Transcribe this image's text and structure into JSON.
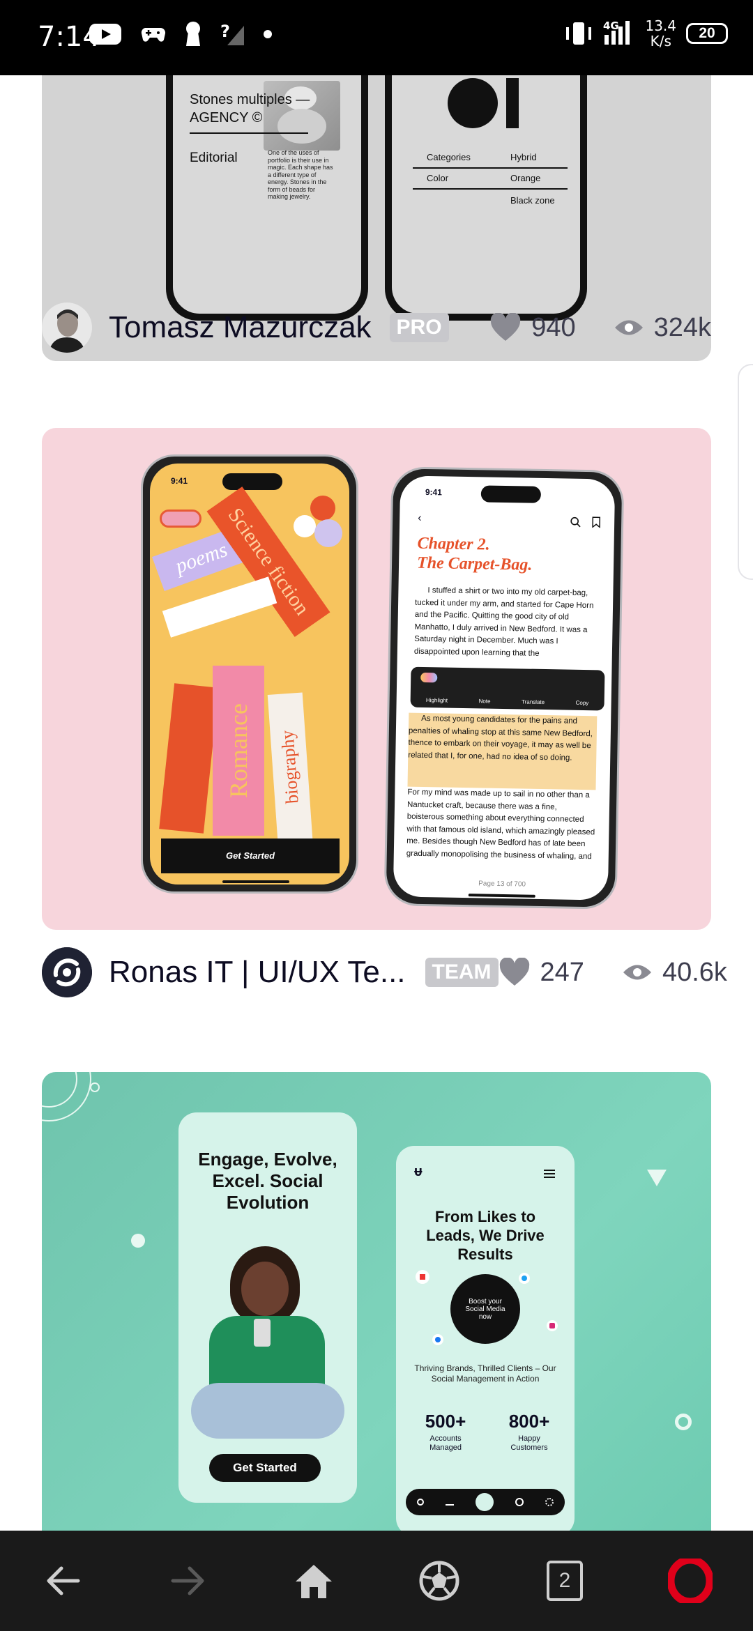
{
  "status_bar": {
    "time": "7:14",
    "net_speed_value": "13.4",
    "net_speed_unit": "K/s",
    "network": "4G",
    "battery": "20"
  },
  "colors": {
    "shot1_bg": "#d3d3d3",
    "shot2_bg": "#f7d5dc",
    "shot3_bg": "#7fd5bd",
    "badge_bg": "#c8c8cc",
    "opera_red": "#e0001a",
    "navbar_bg": "#1a1a1a"
  },
  "shots": [
    {
      "mockup_text": {
        "agency_title": "Stones multiples —",
        "agency_title2": "AGENCY ©",
        "editorial": "Editorial",
        "body": "One of the uses of portfolio is their use in magic. Each shape has a different type of energy. Stones in the form of beads for making jewelry.",
        "row1_label": "Categories",
        "row1_value": "Hybrid",
        "row2_label": "Color",
        "row2_value": "Orange",
        "row3_value": "Black zone"
      },
      "author": "Tomasz Mazurczak",
      "badge": "PRO",
      "likes": "940",
      "views": "324k"
    },
    {
      "mockup_text": {
        "time": "9:41",
        "poems": "poems",
        "science": "Science fiction",
        "romance": "Romance",
        "biography": "biography",
        "get_started": "Get Started",
        "chapter": "Chapter 2.",
        "chapter_title": "The Carpet-Bag.",
        "paragraph1": "I stuffed a shirt or two into my old carpet-bag, tucked it under my arm, and started for Cape Horn and the Pacific. Quitting the good city of old Manhatto, I duly arrived in New Bedford. It was a Saturday night in December. Much was I disappointed upon learning that the",
        "menu": [
          "Highlight",
          "Note",
          "Translate",
          "Copy"
        ],
        "paragraph2_highlight": "As most young candidates for the pains and penalties of whaling stop at this same New Bedford, thence to embark on their voyage, it may as well be related that I, for one, had no idea of so doing.",
        "paragraph2_rest": "For my mind was made up to sail in no other than a Nantucket craft, because there was a fine, boisterous something about everything connected with that famous old island, which amazingly pleased me. Besides though New Bedford has of late been gradually monopolising the business of whaling, and",
        "page": "Page 13 of 700"
      },
      "author": "Ronas IT | UI/UX Te...",
      "badge": "TEAM",
      "likes": "247",
      "views": "40.6k"
    },
    {
      "mockup_text": {
        "headline": "Engage, Evolve, Excel. Social Evolution",
        "get_started": "Get Started",
        "logo": "ᵾ",
        "hero": "From Likes to Leads, We Drive Results",
        "circle_text": "Boost your Social Media now",
        "subtitle": "Thriving Brands, Thrilled Clients – Our Social Management in Action",
        "stat1_value": "500+",
        "stat1_label": "Accounts Managed",
        "stat2_value": "800+",
        "stat2_label": "Happy Customers"
      }
    }
  ],
  "navbar": {
    "tabs_count": "2",
    "icons": [
      "back-icon",
      "forward-icon",
      "home-icon",
      "speed-dial-icon",
      "tabs-icon",
      "opera-menu-icon"
    ]
  }
}
